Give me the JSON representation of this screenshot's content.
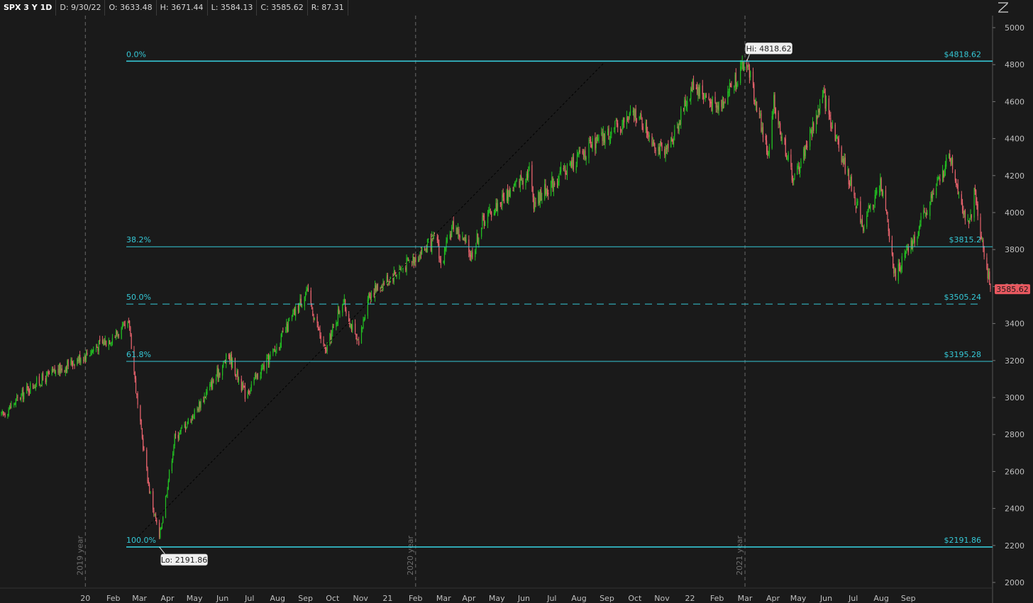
{
  "header": {
    "symbol": "SPX 3 Y 1D",
    "date": "D: 9/30/22",
    "open": "O: 3633.48",
    "high": "H: 3671.44",
    "low": "L: 3584.13",
    "close": "C: 3585.62",
    "range": "R: 87.31"
  },
  "toolbar": {
    "drawing_icon": "fibonacci-tool-icon"
  },
  "colors": {
    "background": "#1a1a1a",
    "up": "#22c022",
    "down": "#e8636d",
    "fib": "#35c8d6",
    "last_price": "#e8585f"
  },
  "chart_data": {
    "type": "candlestick",
    "symbol": "SPX",
    "period": "3 Y",
    "interval": "1D",
    "ylim": [
      1960,
      5080
    ],
    "y_ticks": [
      2000,
      2200,
      2400,
      2600,
      2800,
      3000,
      3200,
      3400,
      3600,
      3800,
      4000,
      4200,
      4400,
      4600,
      4800,
      5000
    ],
    "x_ticks": [
      "20",
      "Feb",
      "Mar",
      "Apr",
      "May",
      "Jun",
      "Jul",
      "Aug",
      "Sep",
      "Oct",
      "Nov",
      "21",
      "Feb",
      "Mar",
      "Apr",
      "May",
      "Jun",
      "Jul",
      "Aug",
      "Sep",
      "Oct",
      "Nov",
      "22",
      "Feb",
      "Mar",
      "Apr",
      "May",
      "Jun",
      "Jul",
      "Aug",
      "Sep"
    ],
    "year_markers": [
      "2019 year",
      "2020 year",
      "2021 year"
    ],
    "start_date": "2019-09-30",
    "end_date": "2022-09-30",
    "last_price": "3585.62",
    "high_label": "Hi: 4818.62",
    "low_label": "Lo: 2191.86",
    "price_path": [
      [
        "2019-09-30",
        2900
      ],
      [
        "2019-11-01",
        3060
      ],
      [
        "2019-12-31",
        3230
      ],
      [
        "2020-02-19",
        3390
      ],
      [
        "2020-02-28",
        2950
      ],
      [
        "2020-03-12",
        2500
      ],
      [
        "2020-03-23",
        2240
      ],
      [
        "2020-04-09",
        2780
      ],
      [
        "2020-04-30",
        2910
      ],
      [
        "2020-06-08",
        3230
      ],
      [
        "2020-06-26",
        3020
      ],
      [
        "2020-07-31",
        3270
      ],
      [
        "2020-09-02",
        3580
      ],
      [
        "2020-09-23",
        3240
      ],
      [
        "2020-10-12",
        3530
      ],
      [
        "2020-10-30",
        3270
      ],
      [
        "2020-11-09",
        3550
      ],
      [
        "2020-12-31",
        3760
      ],
      [
        "2021-01-25",
        3860
      ],
      [
        "2021-01-29",
        3710
      ],
      [
        "2021-02-12",
        3940
      ],
      [
        "2021-03-04",
        3770
      ],
      [
        "2021-03-17",
        3960
      ],
      [
        "2021-05-07",
        4230
      ],
      [
        "2021-05-12",
        4060
      ],
      [
        "2021-06-30",
        4300
      ],
      [
        "2021-09-02",
        4540
      ],
      [
        "2021-10-04",
        4300
      ],
      [
        "2021-11-05",
        4700
      ],
      [
        "2021-11-30",
        4560
      ],
      [
        "2022-01-03",
        4818
      ],
      [
        "2022-01-27",
        4300
      ],
      [
        "2022-02-02",
        4590
      ],
      [
        "2022-02-24",
        4170
      ],
      [
        "2022-03-29",
        4630
      ],
      [
        "2022-05-12",
        3930
      ],
      [
        "2022-06-01",
        4160
      ],
      [
        "2022-06-16",
        3666
      ],
      [
        "2022-07-05",
        3830
      ],
      [
        "2022-08-16",
        4305
      ],
      [
        "2022-09-06",
        3910
      ],
      [
        "2022-09-12",
        4110
      ],
      [
        "2022-09-30",
        3585
      ]
    ],
    "fibonacci": {
      "high": 4818.62,
      "low": 2191.86,
      "levels": [
        {
          "ratio": "0.0%",
          "price": 4818.62,
          "label": "$4818.62",
          "style": "solid"
        },
        {
          "ratio": "38.2%",
          "price": 3815.2,
          "label": "$3815.2",
          "style": "solid"
        },
        {
          "ratio": "50.0%",
          "price": 3505.24,
          "label": "$3505.24",
          "style": "dashed"
        },
        {
          "ratio": "61.8%",
          "price": 3195.28,
          "label": "$3195.28",
          "style": "solid"
        },
        {
          "ratio": "100.0%",
          "price": 2191.86,
          "label": "$2191.86",
          "style": "solid"
        }
      ]
    }
  }
}
